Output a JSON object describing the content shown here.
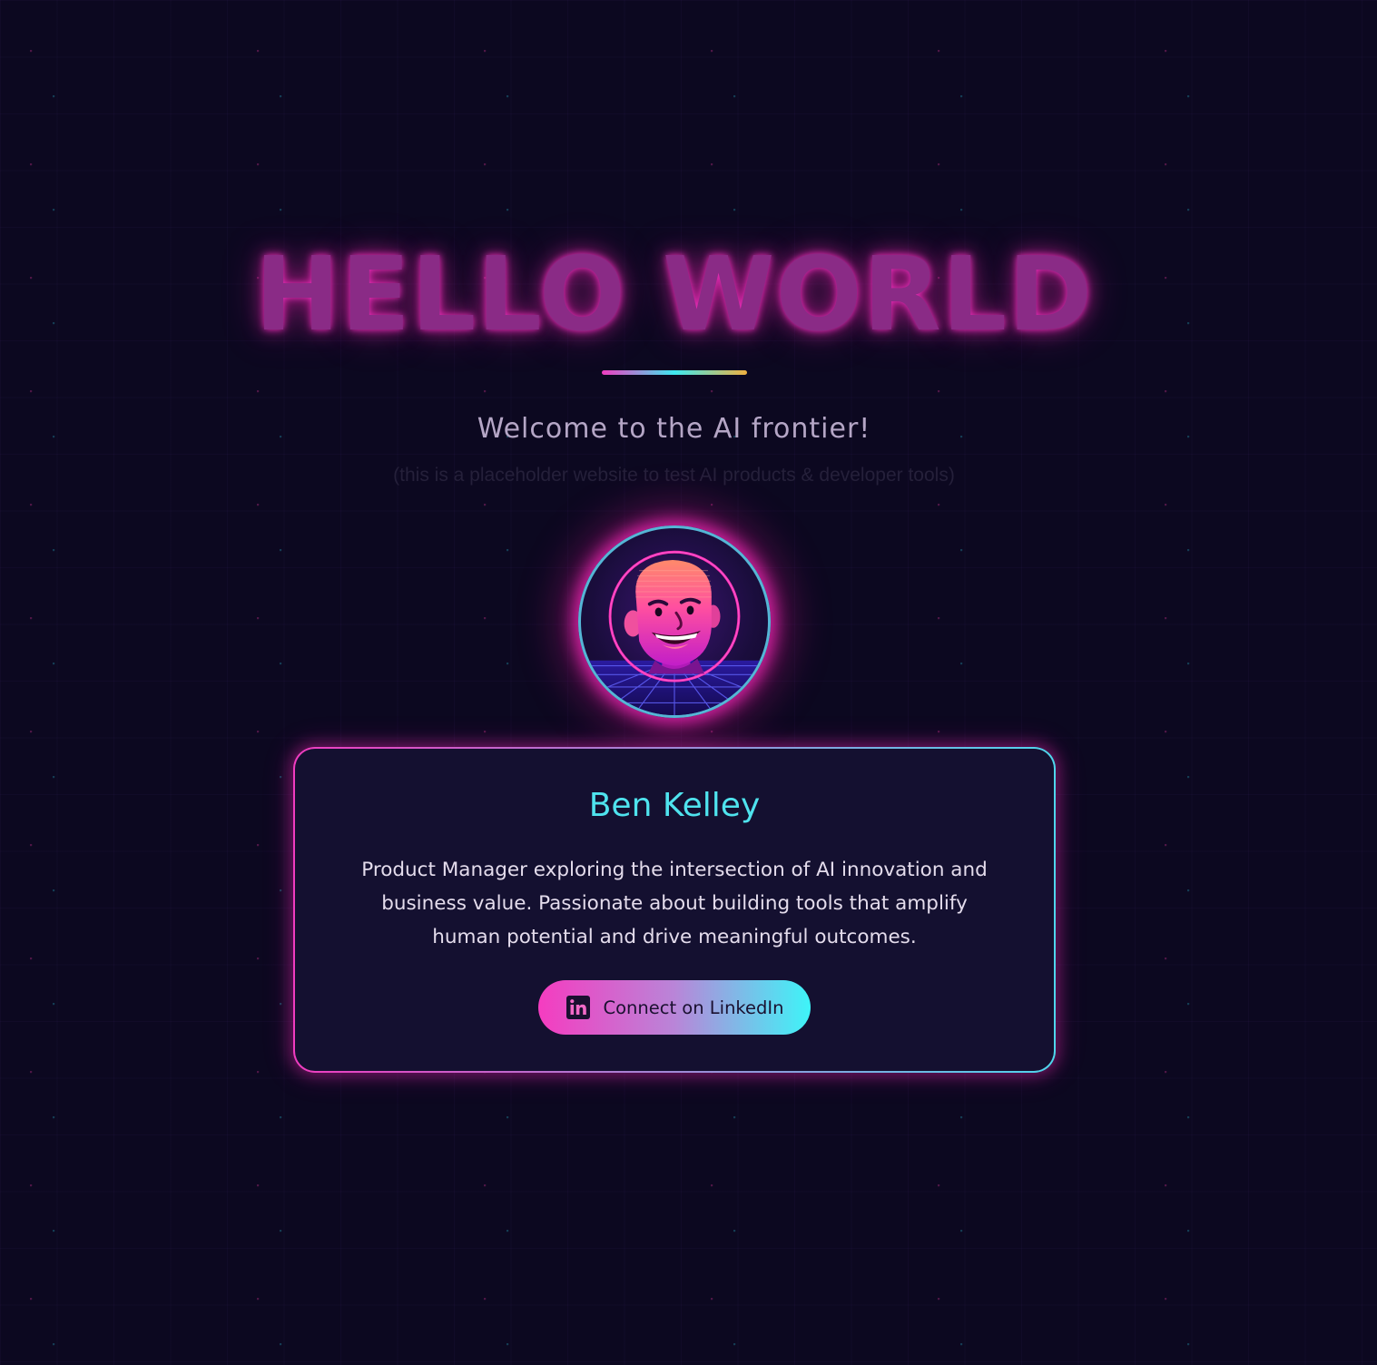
{
  "hero": {
    "title": "HELLO WORLD",
    "subtitle": "Welcome to the AI frontier!",
    "disclaimer": "(this is a placeholder website to test AI products & developer tools)"
  },
  "avatar": {
    "icon": "cartoon-portrait-avatar",
    "alt": "Ben Kelley avatar"
  },
  "profile": {
    "name": "Ben Kelley",
    "bio": "Product Manager exploring the intersection of AI innovation and business value. Passionate about building tools that amplify human potential and drive meaningful outcomes.",
    "cta": {
      "label": "Connect on LinkedIn",
      "icon": "linkedin-icon"
    }
  },
  "colors": {
    "background": "#0c0820",
    "neon_pink": "#f03cc0",
    "neon_cyan": "#4fe3ee",
    "card_background": "#141030"
  }
}
